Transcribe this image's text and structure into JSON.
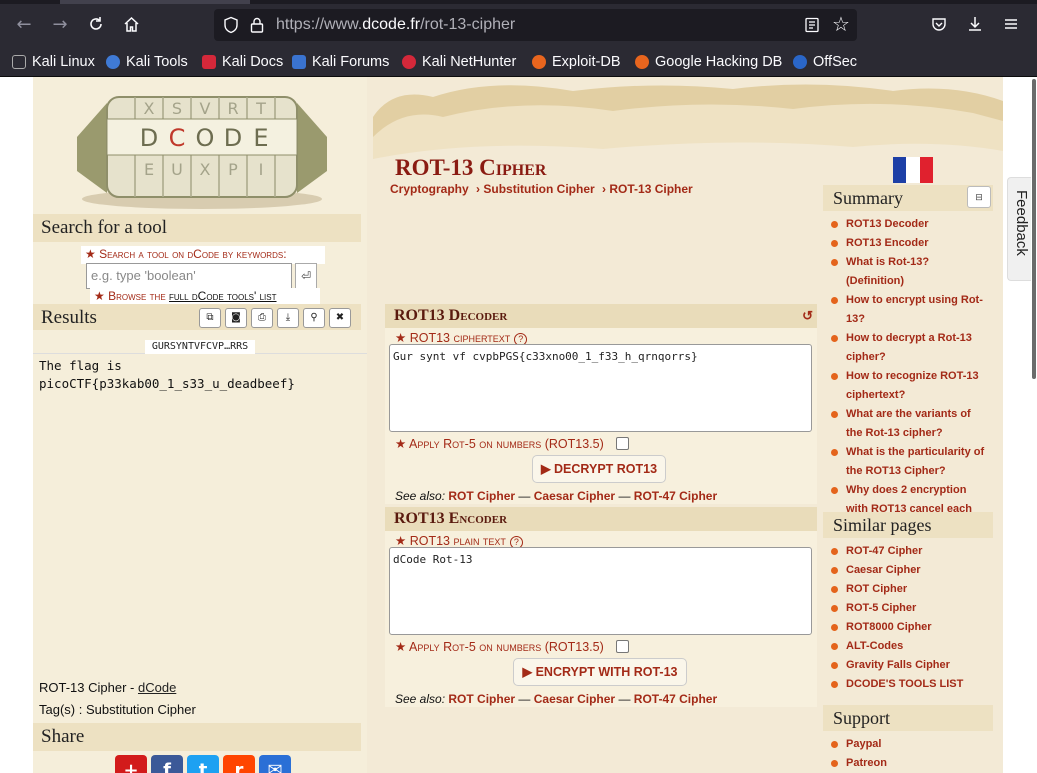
{
  "browser": {
    "url_prefix": "https://www.",
    "url_host": "dcode.fr",
    "url_path": "/rot-13-cipher",
    "bookmarks": [
      "Kali Linux",
      "Kali Tools",
      "Kali Docs",
      "Kali Forums",
      "Kali NetHunter",
      "Exploit-DB",
      "Google Hacking DB",
      "OffSec"
    ],
    "colors": {
      "chrome": "#2b2a33",
      "url_bg": "#1c1b22"
    }
  },
  "left": {
    "search_title": "Search for a tool",
    "search_label": "★ Search a tool on dCode by keywords:",
    "search_placeholder": "e.g. type 'boolean'",
    "search_go_icon": "return-icon",
    "browse_prefix": "★ Browse the ",
    "browse_link": "full dCode tools' list",
    "results_title": "Results",
    "result_header": "GURSYNTVFCVP…RRS",
    "result_text": "The flag is\npicoCTF{p33kab00_1_s33_u_deadbeef}",
    "tool_name": "ROT-13 Cipher - ",
    "tool_site": "dCode",
    "tags": "Tag(s) : Substitution Cipher",
    "share_title": "Share"
  },
  "main": {
    "title": "ROT-13 Cipher",
    "breadcrumbs": [
      "Cryptography",
      "› Substitution Cipher",
      "› ROT-13 Cipher"
    ],
    "decoder": {
      "title": "ROT13 Decoder",
      "field_label": "ROT13 ciphertext",
      "text": "Gur synt vf cvpbPGS{c33xno00_1_f33_h_qrnqorrs}",
      "checkbox_label": "Apply Rot-5 on numbers (ROT13.5)",
      "button": "▶ DECRYPT ROT13",
      "see_also_label": "See also:",
      "see_also": [
        "ROT Cipher",
        "Caesar Cipher",
        "ROT-47 Cipher"
      ]
    },
    "encoder": {
      "title": "ROT13 Encoder",
      "field_label": "ROT13 plain text",
      "text": "dCode Rot-13",
      "checkbox_label": "Apply Rot-5 on numbers (ROT13.5)",
      "button": "▶ ENCRYPT WITH ROT-13",
      "see_also_label": "See also:",
      "see_also": [
        "ROT Cipher",
        "Caesar Cipher",
        "ROT-47 Cipher"
      ]
    }
  },
  "right": {
    "summary_title": "Summary",
    "summary_items": [
      "ROT13 Decoder",
      "ROT13 Encoder",
      "What is Rot-13? (Definition)",
      "How to encrypt using Rot-13?",
      "How to decrypt a Rot-13 cipher?",
      "How to recognize ROT-13 ciphertext?",
      "What are the variants of the Rot-13 cipher?",
      "What is the particularity of the ROT13 Cipher?",
      "Why does 2 encryption with ROT13 cancel each other?"
    ],
    "similar_title": "Similar pages",
    "similar_items": [
      "ROT-47 Cipher",
      "Caesar Cipher",
      "ROT Cipher",
      "ROT-5 Cipher",
      "ROT8000 Cipher",
      "ALT-Codes",
      "Gravity Falls Cipher",
      "DCODE'S TOOLS LIST"
    ],
    "support_title": "Support",
    "support_items": [
      "Paypal",
      "Patreon"
    ],
    "feedback": "Feedback"
  },
  "colors": {
    "accent": "#a32a17",
    "title": "#8a1b12",
    "parchment": "#f3ead6"
  }
}
